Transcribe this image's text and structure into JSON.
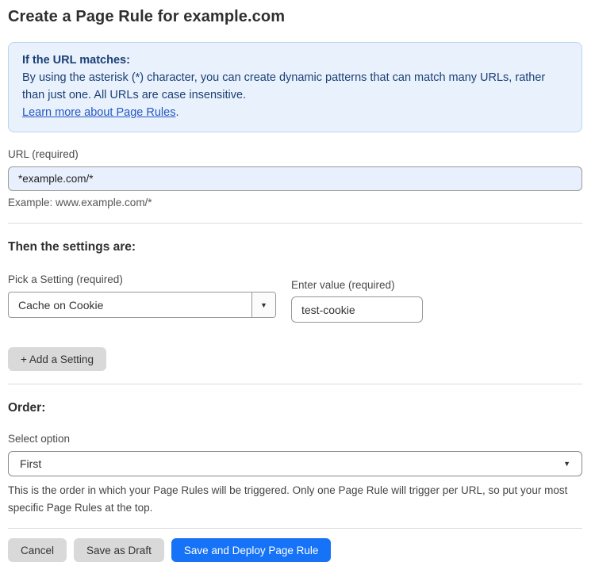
{
  "page": {
    "title": "Create a Page Rule for example.com"
  },
  "info_box": {
    "heading": "If the URL matches:",
    "body": "By using the asterisk (*) character, you can create dynamic patterns that can match many URLs, rather than just one. All URLs are case insensitive.",
    "link_label": "Learn more about Page Rules",
    "link_suffix": "."
  },
  "url_field": {
    "label": "URL (required)",
    "value": "*example.com/*",
    "hint": "Example: www.example.com/*"
  },
  "settings_section": {
    "heading": "Then the settings are:",
    "setting_select": {
      "label": "Pick a Setting (required)",
      "value": "Cache on Cookie",
      "arrow_icon": "▼"
    },
    "value_field": {
      "label": "Enter value (required)",
      "value": "test-cookie"
    },
    "add_setting_button": "+ Add a Setting"
  },
  "order_section": {
    "heading": "Order:",
    "select_label": "Select option",
    "selected_option": "First",
    "arrow_icon": "▼",
    "help_text": "This is the order in which your Page Rules will be triggered. Only one Page Rule will trigger per URL, so put your most specific Page Rules at the top."
  },
  "footer": {
    "cancel_label": "Cancel",
    "save_draft_label": "Save as Draft",
    "save_deploy_label": "Save and Deploy Page Rule"
  },
  "colors": {
    "accent_blue": "#1672f6",
    "info_background": "#e9f2fc",
    "info_border": "#b9d5f0",
    "info_text": "#1b3f77",
    "link_blue": "#2456c4",
    "autofill_input_background": "#e8f0fe",
    "gray_button_background": "#d9d9d9"
  }
}
